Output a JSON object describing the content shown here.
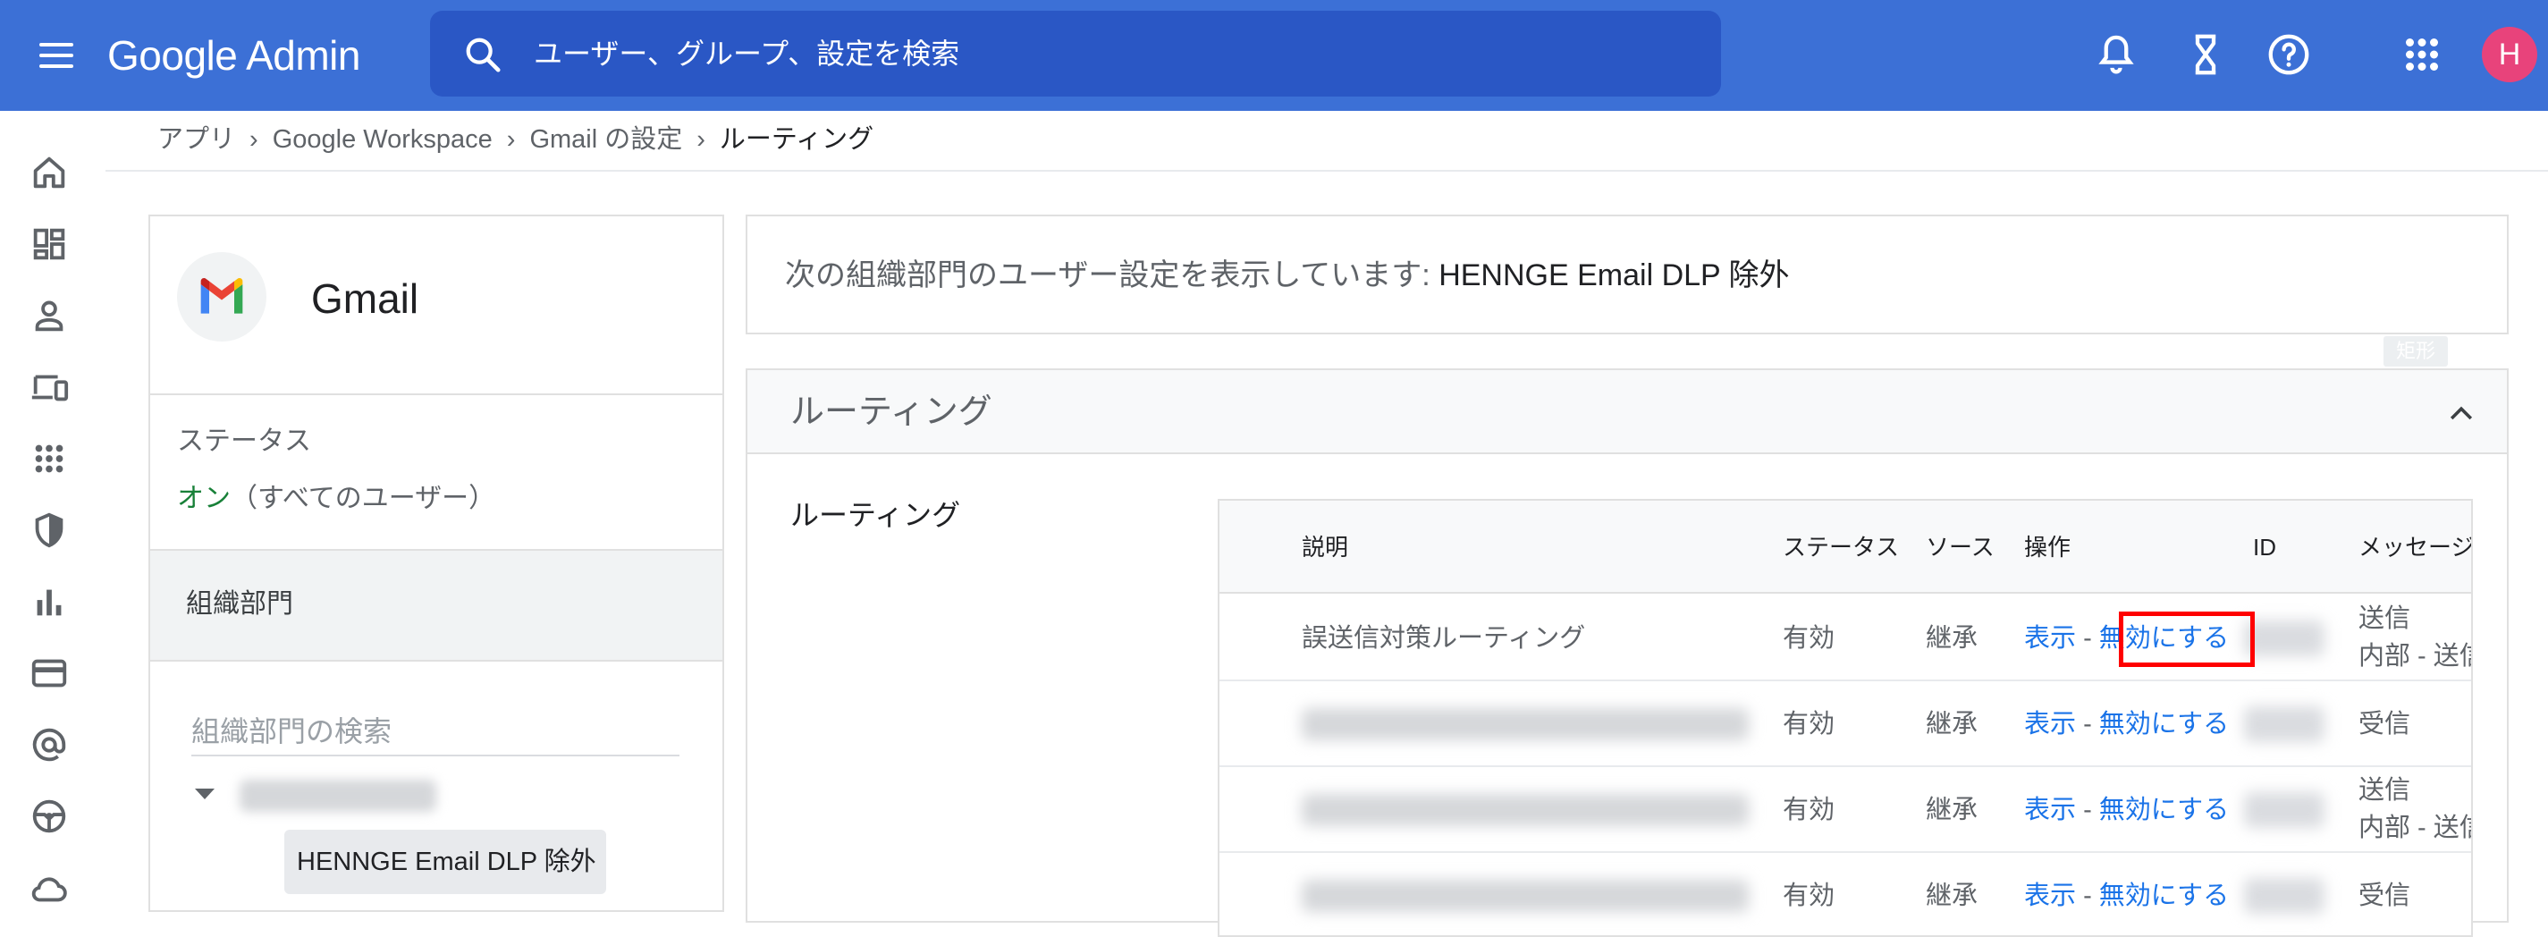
{
  "topbar": {
    "menu_icon": "hamburger-menu-icon",
    "logo_google": "Google",
    "logo_admin": "Admin",
    "search_placeholder": "ユーザー、グループ、設定を検索",
    "avatar_initial": "H",
    "colors": {
      "bar": "#3c70d6",
      "search": "#2a57c5",
      "avatar": "#e8437b"
    }
  },
  "rail": [
    "home-icon",
    "dashboard-icon",
    "user-icon",
    "devices-icon",
    "apps-icon",
    "security-icon",
    "reports-icon",
    "billing-icon",
    "account-icon",
    "rules-icon",
    "storage-icon"
  ],
  "breadcrumb": [
    "アプリ",
    "Google Workspace",
    "Gmail の設定",
    "ルーティング"
  ],
  "appcard": {
    "title": "Gmail",
    "status_label": "ステータス",
    "status_on": "オン",
    "status_scope": "（すべてのユーザー）",
    "ou_header": "組織部門",
    "ou_search_placeholder": "組織部門の検索",
    "ou_selected": "HENNGE Email DLP 除外"
  },
  "info": {
    "prefix": "次の組織部門のユーザー設定を表示しています: ",
    "ou_name": "HENNGE Email DLP 除外"
  },
  "tag_label": "矩形",
  "panel": {
    "title": "ルーティング",
    "sub_label": "ルーティング",
    "table": {
      "headers": [
        "説明",
        "ステータス",
        "ソース",
        "操作",
        "ID",
        "メッセージ"
      ],
      "rows": [
        {
          "desc": "誤送信対策ルーティング",
          "status": "有効",
          "source": "継承",
          "view": "表示",
          "sep": " - ",
          "disable": "無効にする",
          "msg1": "送信",
          "msg2": "内部 - 送信"
        },
        {
          "desc": "",
          "status": "有効",
          "source": "継承",
          "view": "表示",
          "sep": " - ",
          "disable": "無効にする",
          "msg1": "受信",
          "msg2": ""
        },
        {
          "desc": "",
          "status": "有効",
          "source": "継承",
          "view": "表示",
          "sep": " - ",
          "disable": "無効にする",
          "msg1": "送信",
          "msg2": "内部 - 送信"
        },
        {
          "desc": "",
          "status": "有効",
          "source": "継承",
          "view": "表示",
          "sep": " - ",
          "disable": "無効にする",
          "msg1": "受信",
          "msg2": ""
        }
      ]
    }
  }
}
